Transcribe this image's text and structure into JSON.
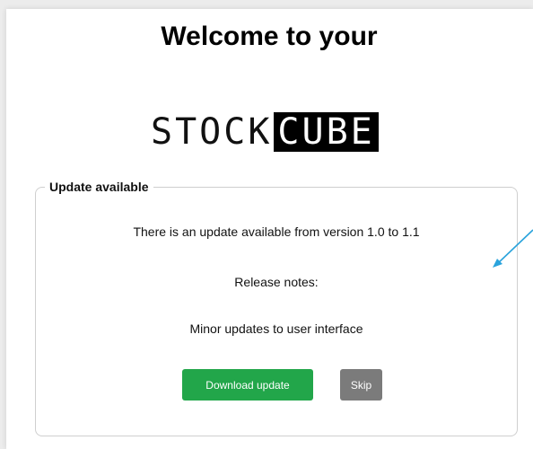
{
  "header": {
    "title": "Welcome to your"
  },
  "logo": {
    "part1": "STOCK",
    "part2": "CUBE"
  },
  "update_panel": {
    "legend": "Update available",
    "message": "There is an update available from version 1.0 to 1.1",
    "notes_label": "Release notes:",
    "notes_text": "Minor updates to user interface"
  },
  "buttons": {
    "download": "Download update",
    "skip": "Skip"
  },
  "colors": {
    "download": "#22a64a",
    "skip": "#7b7b7b",
    "pointer": "#2aa3dc"
  },
  "icons": {
    "pointer": "arrow-pointer-icon"
  }
}
